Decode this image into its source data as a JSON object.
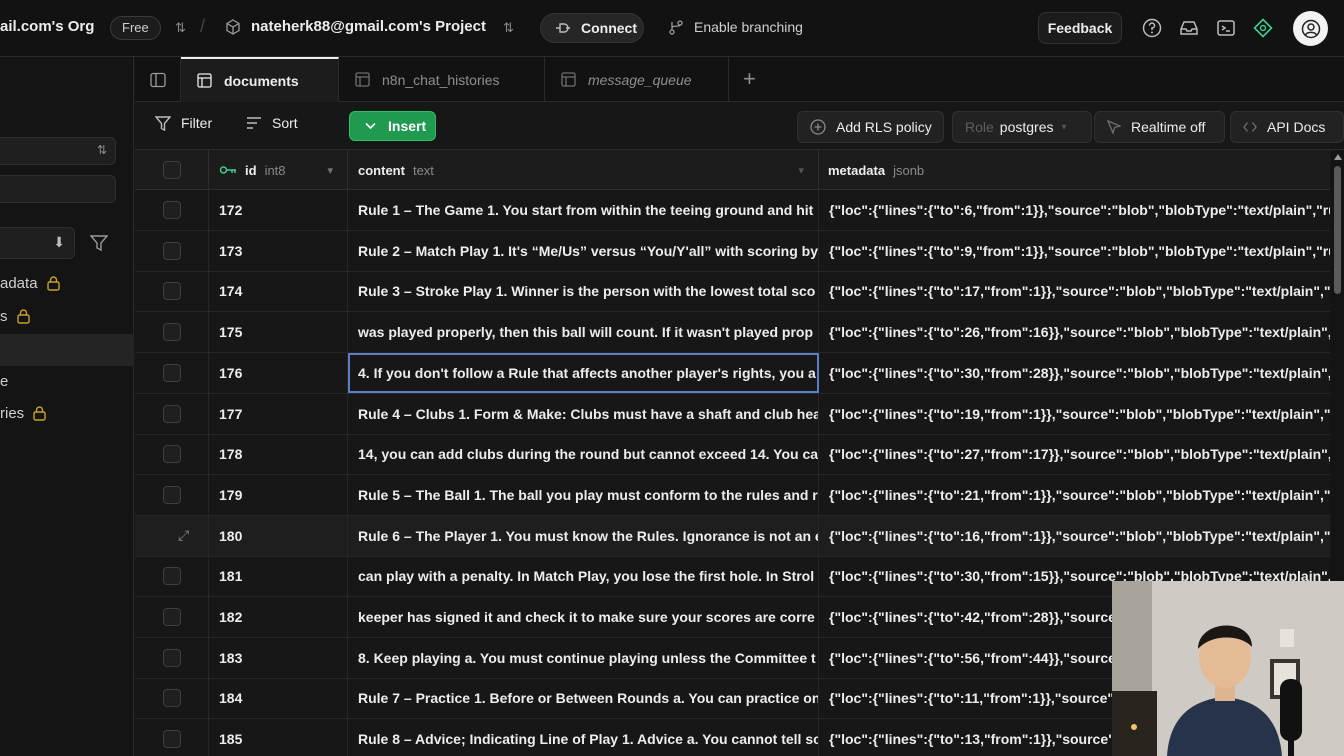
{
  "topbar": {
    "org_name": "ail.com's Org",
    "plan_badge": "Free",
    "project_name": "nateherk88@gmail.com's Project",
    "connect_label": "Connect",
    "branching_label": "Enable branching",
    "feedback_label": "Feedback"
  },
  "sidebar": {
    "items": [
      {
        "label": "adata",
        "locked": true
      },
      {
        "label": "s",
        "locked": true
      },
      {
        "label": "",
        "locked": false
      },
      {
        "label": "e",
        "locked": false
      },
      {
        "label": "ries",
        "locked": true
      }
    ]
  },
  "tabs": [
    {
      "label": "documents",
      "active": true
    },
    {
      "label": "n8n_chat_histories",
      "active": false
    },
    {
      "label": "message_queue",
      "active": false
    }
  ],
  "toolbar": {
    "filter_label": "Filter",
    "sort_label": "Sort",
    "insert_label": "Insert",
    "rls_label": "Add RLS policy",
    "role_prefix": "Role",
    "role_value": "postgres",
    "realtime_label": "Realtime off",
    "api_docs_label": "API Docs"
  },
  "columns": [
    {
      "name": "id",
      "type": "int8"
    },
    {
      "name": "content",
      "type": "text"
    },
    {
      "name": "metadata",
      "type": "jsonb"
    }
  ],
  "rows": [
    {
      "id": "172",
      "content": "Rule 1 – The Game 1. You start from within the teeing ground and hit",
      "metadata": "{\"loc\":{\"lines\":{\"to\":6,\"from\":1}},\"source\":\"blob\",\"blobType\":\"text/plain\",\"rul"
    },
    {
      "id": "173",
      "content": "Rule 2 – Match Play 1. It's “Me/Us” versus “You/Y'all” with scoring by",
      "metadata": "{\"loc\":{\"lines\":{\"to\":9,\"from\":1}},\"source\":\"blob\",\"blobType\":\"text/plain\",\"rul"
    },
    {
      "id": "174",
      "content": "Rule 3 – Stroke Play 1. Winner is the person with the lowest total sco",
      "metadata": "{\"loc\":{\"lines\":{\"to\":17,\"from\":1}},\"source\":\"blob\",\"blobType\":\"text/plain\",\"rul"
    },
    {
      "id": "175",
      "content": "was played properly, then this ball will count. If it wasn't played prop",
      "metadata": "{\"loc\":{\"lines\":{\"to\":26,\"from\":16}},\"source\":\"blob\",\"blobType\":\"text/plain\",\"r"
    },
    {
      "id": "176",
      "content": "4. If you don't follow a Rule that affects another player's rights, you a",
      "metadata": "{\"loc\":{\"lines\":{\"to\":30,\"from\":28}},\"source\":\"blob\",\"blobType\":\"text/plain\",\""
    },
    {
      "id": "177",
      "content": "Rule 4 – Clubs 1. Form & Make: Clubs must have a shaft and club hea",
      "metadata": "{\"loc\":{\"lines\":{\"to\":19,\"from\":1}},\"source\":\"blob\",\"blobType\":\"text/plain\",\"ru"
    },
    {
      "id": "178",
      "content": "14, you can add clubs during the round but cannot exceed 14. You ca",
      "metadata": "{\"loc\":{\"lines\":{\"to\":27,\"from\":17}},\"source\":\"blob\",\"blobType\":\"text/plain\",\"r"
    },
    {
      "id": "179",
      "content": "Rule 5 – The Ball 1. The ball you play must conform to the rules and r",
      "metadata": "{\"loc\":{\"lines\":{\"to\":21,\"from\":1}},\"source\":\"blob\",\"blobType\":\"text/plain\",\"ru"
    },
    {
      "id": "180",
      "content": "Rule 6 – The Player 1. You must know the Rules. Ignorance is not an e",
      "metadata": "{\"loc\":{\"lines\":{\"to\":16,\"from\":1}},\"source\":\"blob\",\"blobType\":\"text/plain\",\"ru"
    },
    {
      "id": "181",
      "content": "can play with a penalty. In Match Play, you lose the first hole. In Strol",
      "metadata": "{\"loc\":{\"lines\":{\"to\":30,\"from\":15}},\"source\":\"blob\",\"blobType\":\"text/plain\",\"r"
    },
    {
      "id": "182",
      "content": "keeper has signed it and check it to make sure your scores are corre",
      "metadata": "{\"loc\":{\"lines\":{\"to\":42,\"from\":28}},\"source\""
    },
    {
      "id": "183",
      "content": "8. Keep playing a. You must continue playing unless the Committee t",
      "metadata": "{\"loc\":{\"lines\":{\"to\":56,\"from\":44}},\"source\""
    },
    {
      "id": "184",
      "content": "Rule 7 – Practice 1. Before or Between Rounds a. You can practice on",
      "metadata": "{\"loc\":{\"lines\":{\"to\":11,\"from\":1}},\"source\":\"b"
    },
    {
      "id": "185",
      "content": "Rule 8 – Advice; Indicating Line of Play 1. Advice a. You cannot tell sc",
      "metadata": "{\"loc\":{\"lines\":{\"to\":13,\"from\":1}},\"source\":\"b"
    }
  ],
  "selected_row_id": "176",
  "hovered_row_id": "180",
  "colors": {
    "background": "#171717",
    "accent_green": "#1f9a4f",
    "selection_outline": "#5b7ec8"
  }
}
